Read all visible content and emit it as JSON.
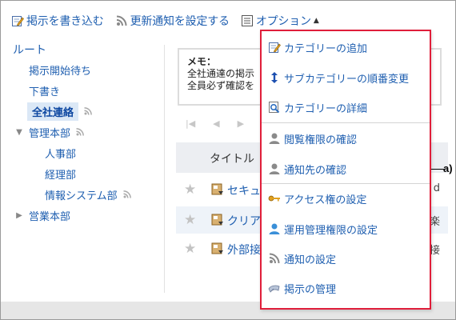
{
  "toolbar": {
    "post_label": "掲示を書き込む",
    "notify_label": "更新通知を設定する",
    "options_label": "オプション"
  },
  "sidebar": {
    "root": "ルート",
    "items": [
      {
        "label": "掲示開始待ち"
      },
      {
        "label": "下書き"
      },
      {
        "label": "全社連絡"
      },
      {
        "label": "管理本部"
      },
      {
        "label": "人事部"
      },
      {
        "label": "経理部"
      },
      {
        "label": "情報システム部"
      },
      {
        "label": "営業本部"
      }
    ]
  },
  "memo": {
    "title": "メモ：",
    "line1": "全社通達の掲示",
    "line2": "全員必ず確認を"
  },
  "table": {
    "header_title": "タイトル",
    "header_edge": "",
    "rows": [
      {
        "title": "セキュ",
        "edge": "d"
      },
      {
        "title": "クリア",
        "edge": "楽"
      },
      {
        "title": "外部接",
        "edge": "接"
      }
    ]
  },
  "menu": {
    "items": [
      {
        "label": "カテゴリーの追加"
      },
      {
        "label": "サブカテゴリーの順番変更"
      },
      {
        "label": "カテゴリーの詳細"
      },
      {
        "label": "閲覧権限の確認"
      },
      {
        "label": "通知先の確認"
      },
      {
        "label": "アクセス権の設定"
      },
      {
        "label": "運用管理権限の設定"
      },
      {
        "label": "通知の設定"
      },
      {
        "label": "掲示の管理"
      }
    ]
  },
  "annotation": {
    "callout": "a)"
  },
  "colors": {
    "link": "#1f5fb0",
    "menu_border": "#e01e3a",
    "selected_bg": "#dbe8f6"
  }
}
